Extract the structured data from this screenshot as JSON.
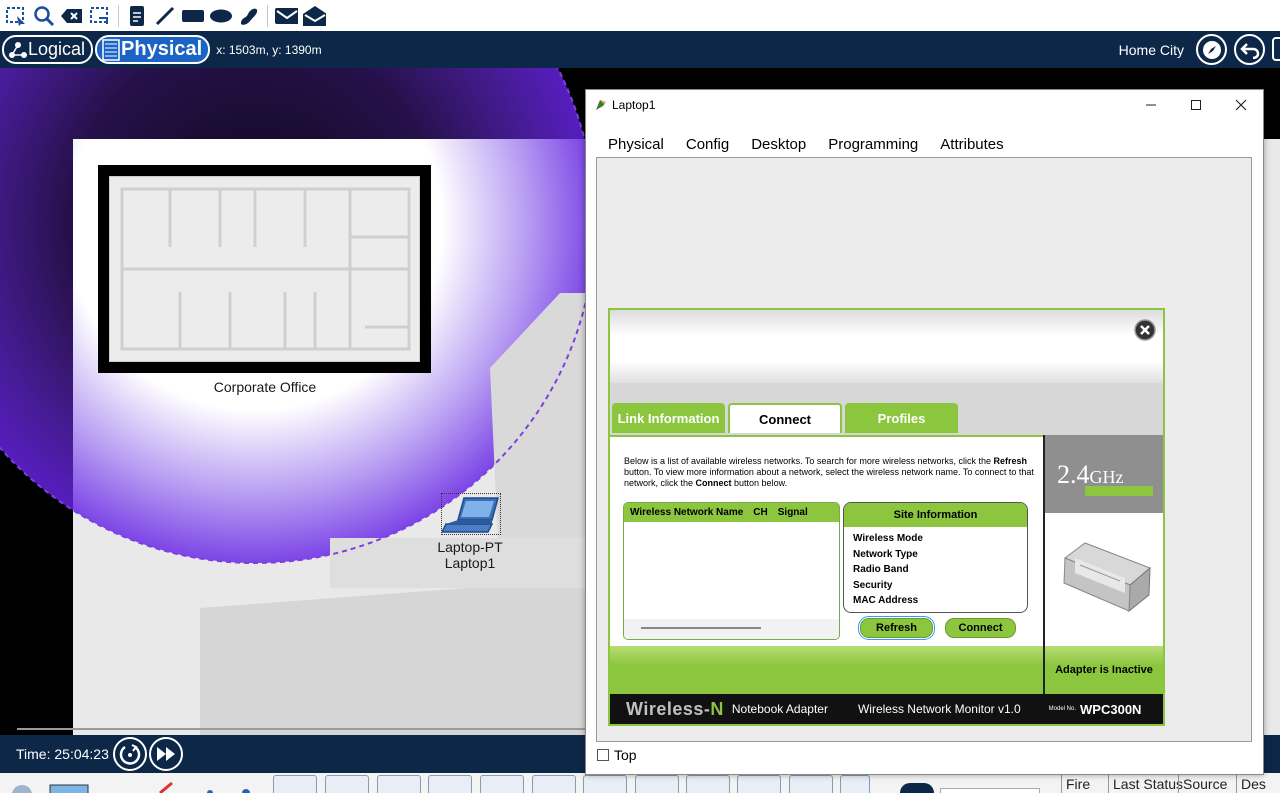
{
  "toolbar": {
    "icons": [
      "select-icon",
      "zoom-icon",
      "delete-icon",
      "resize-icon",
      "note-icon",
      "line-icon",
      "rectangle-icon",
      "ellipse-icon",
      "freeform-icon",
      "simple-pdu-icon",
      "complex-pdu-icon"
    ]
  },
  "modebar": {
    "logical_label": "Logical",
    "physical_label": "Physical",
    "coordinates": "x: 1503m, y: 1390m",
    "location": "Home City"
  },
  "workspace": {
    "office_label": "Corporate Office",
    "device_type": "Laptop-PT",
    "device_name": "Laptop1"
  },
  "statusbar": {
    "time": "Time: 25:04:23"
  },
  "pdu_panel": {
    "columns": [
      "Fire",
      "Last Status",
      "Source",
      "Des"
    ]
  },
  "dialog": {
    "title": "Laptop1",
    "tabs": [
      "Physical",
      "Config",
      "Desktop",
      "Programming",
      "Attributes"
    ],
    "active_tab": "Desktop",
    "top_checkbox_label": "Top"
  },
  "wireless_app": {
    "tabs": [
      "Link Information",
      "Connect",
      "Profiles"
    ],
    "active_tab": "Connect",
    "description_part1": "Below is a list of available wireless networks. To search for more wireless networks, click the ",
    "description_bold1": "Refresh",
    "description_part2": " button. To view more information about a network, select the wireless network name. To connect to that network, click the ",
    "description_bold2": "Connect",
    "description_part3": " button below.",
    "network_list_headers": [
      "Wireless Network Name",
      "CH",
      "Signal"
    ],
    "site_info_title": "Site Information",
    "site_info_fields": [
      "Wireless Mode",
      "Network Type",
      "Radio Band",
      "Security",
      "MAC Address"
    ],
    "refresh_label": "Refresh",
    "connect_label": "Connect",
    "band_number": "2.4",
    "band_unit": "GHz",
    "adapter_status": "Adapter is Inactive",
    "brand_wireless": "Wireless-",
    "brand_n": "N",
    "product_type": "Notebook Adapter",
    "app_name": "Wireless Network Monitor  v1.0",
    "model_prefix": "Model No.",
    "model_number": "WPC300N"
  },
  "colors": {
    "navy": "#0c2747",
    "linksys_green": "#8cc63f",
    "coverage_purple": "#7b3fe4"
  }
}
